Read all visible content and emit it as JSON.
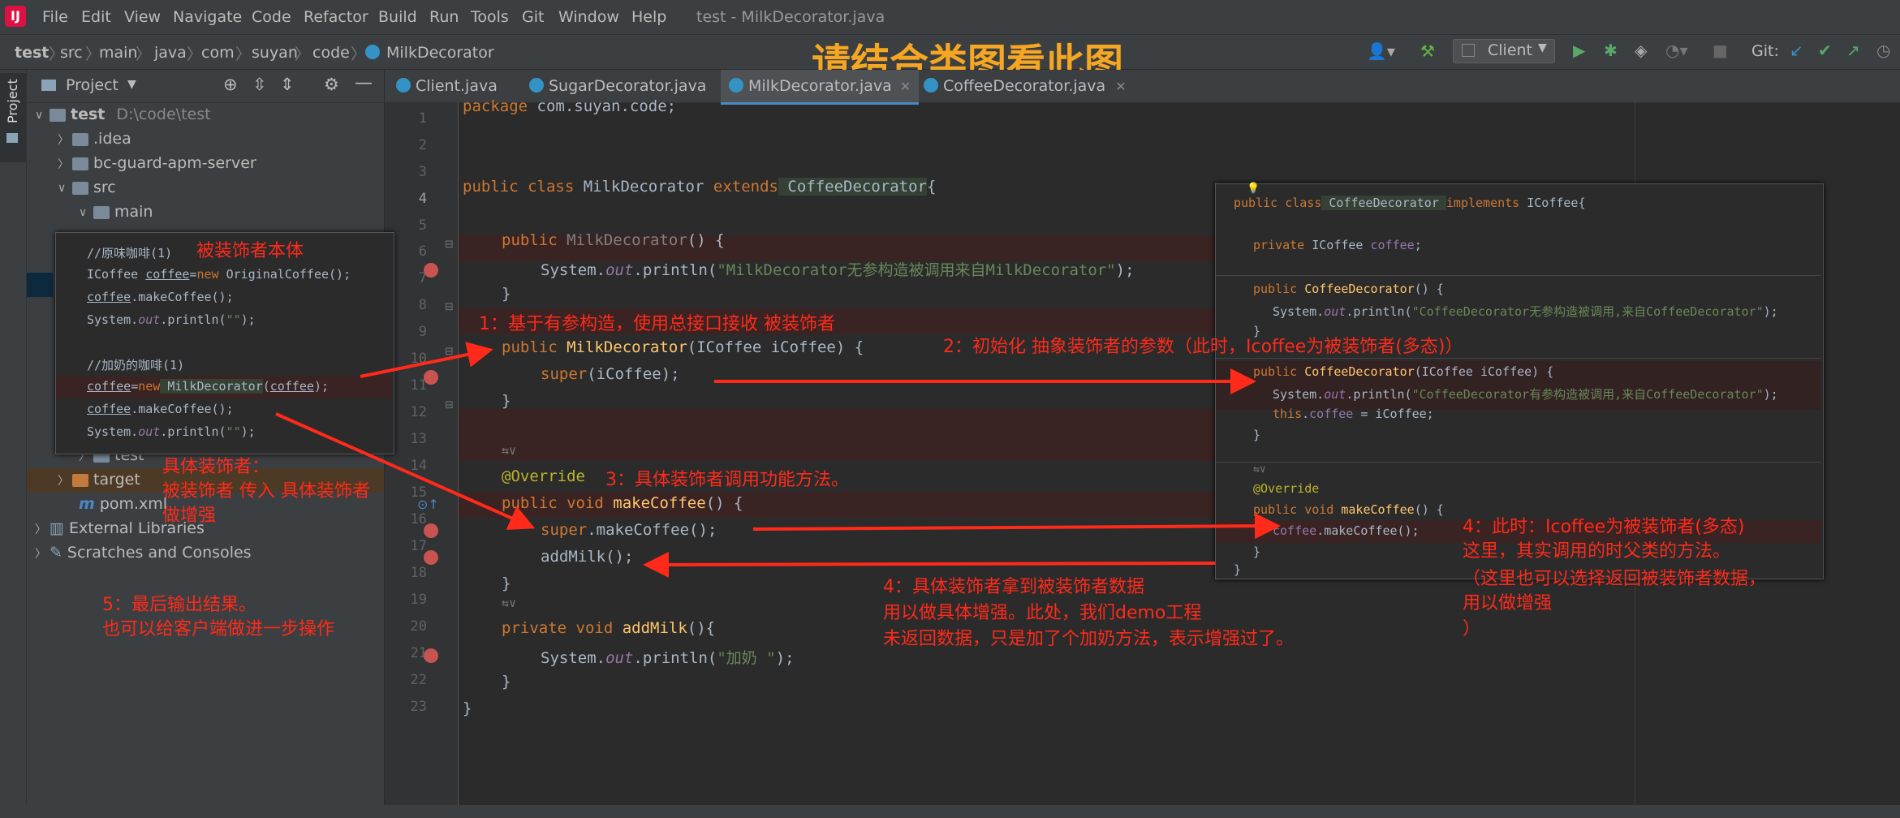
{
  "menubar": {
    "items": [
      "File",
      "Edit",
      "View",
      "Navigate",
      "Code",
      "Refactor",
      "Build",
      "Run",
      "Tools",
      "Git",
      "Window",
      "Help"
    ],
    "window_title": "test - MilkDecorator.java"
  },
  "breadcrumb": [
    "test",
    "src",
    "main",
    "java",
    "com",
    "suyan",
    "code",
    "MilkDecorator"
  ],
  "banner": "请结合类图看此图",
  "toolbar": {
    "run_config": "Client",
    "git_label": "Git:"
  },
  "project_panel": {
    "title": "Project",
    "root_name": "test",
    "root_path": "D:\\code\\test",
    "items": [
      ".idea",
      "bc-guard-apm-server",
      "src",
      "main",
      "test",
      "target",
      "pom.xml",
      "External Libraries",
      "Scratches and Consoles"
    ]
  },
  "tabs": [
    "Client.java",
    "SugarDecorator.java",
    "MilkDecorator.java",
    "CoffeeDecorator.java"
  ],
  "line_numbers": [
    "1",
    "2",
    "3",
    "4",
    "5",
    "6",
    "7",
    "8",
    "9",
    "10",
    "11",
    "12",
    "13",
    "14",
    "15",
    "16",
    "17",
    "18",
    "19",
    "20",
    "21",
    "22",
    "23"
  ],
  "code": {
    "l1_kw": "package",
    "l1_rest": " com.suyan.code;",
    "l4_kw1": "public class",
    "l4_name": " MilkDecorator ",
    "l4_kw2": "extends",
    "l4_sup": " CoffeeDecorator",
    "l4_end": "{",
    "l6_kw": "public",
    "l6_name": " MilkDecorator",
    "l6_end": "() {",
    "l7_a": "System.",
    "l7_out": "out",
    "l7_b": ".println(",
    "l7_str": "\"MilkDecorator无参构造被调用来自MilkDecorator\"",
    "l7_c": ");",
    "l8": "}",
    "l10_kw": "public",
    "l10_name": " MilkDecorator",
    "l10_rest": "(ICoffee iCoffee) {",
    "l11_kw": "super",
    "l11_rest": "(iCoffee);",
    "l12": "}",
    "l14_hint": "⇆∨",
    "l15_ann": "@Override",
    "l16_kw": "public void",
    "l16_name": " makeCoffee",
    "l16_rest": "() {",
    "l17_kw": "super",
    "l17_rest": ".makeCoffee();",
    "l18": "addMilk();",
    "l19": "}",
    "l20_hint": "⇆∨",
    "l21_kw": "private void",
    "l21_name": " addMilk",
    "l21_rest": "(){",
    "l22_a": "System.",
    "l22_out": "out",
    "l22_b": ".println(",
    "l22_str": "\"加奶 \"",
    "l22_c": ");",
    "l23": "}",
    "l24": "}"
  },
  "popup_left": {
    "c1": "//原味咖啡(1)",
    "l1_a": "ICoffee ",
    "l1_var": "coffee",
    "l1_b": "=",
    "l1_kw": "new",
    "l1_c": " OriginalCoffee();",
    "l2_var": "coffee",
    "l2_rest": ".makeCoffee();",
    "l3_a": "System.",
    "l3_out": "out",
    "l3_b": ".println(",
    "l3_str": "\"\"",
    "l3_c": ");",
    "c2": "//加奶的咖啡(1)",
    "l4_var": "coffee",
    "l4_b": "=",
    "l4_kw": "new",
    "l4_cls": " MilkDecorator",
    "l4_c": "(",
    "l4_arg": "coffee",
    "l4_d": ");",
    "l5_var": "coffee",
    "l5_rest": ".makeCoffee();",
    "l6_a": "System.",
    "l6_out": "out",
    "l6_b": ".println(",
    "l6_str": "\"\"",
    "l6_c": ");"
  },
  "popup_right": {
    "l1_kw": "public class",
    "l1_name": " CoffeeDecorator ",
    "l1_kw2": "implements",
    "l1_rest": " ICoffee{",
    "l2_kw": "private",
    "l2_type": " ICoffee ",
    "l2_fld": "coffee",
    "l2_end": ";",
    "l3_kw": "public",
    "l3_name": " CoffeeDecorator",
    "l3_rest": "() {",
    "l4_a": "System.",
    "l4_out": "out",
    "l4_b": ".println(",
    "l4_str": "\"CoffeeDecorator无参构造被调用,来自CoffeeDecorator\"",
    "l4_c": ");",
    "l5": "}",
    "l6_kw": "public",
    "l6_name": " CoffeeDecorator",
    "l6_rest": "(ICoffee iCoffee) {",
    "l7_a": "System.",
    "l7_out": "out",
    "l7_b": ".println(",
    "l7_str": "\"CoffeeDecorator有参构造被调用,来自CoffeeDecorator\"",
    "l7_c": ");",
    "l8_kw": "this",
    "l8_b": ".",
    "l8_fld": "coffee",
    "l8_c": " = iCoffee;",
    "l9": "}",
    "l10_hint": "⇆∨",
    "l11_ann": "@Override",
    "l12_kw": "public void",
    "l12_name": " makeCoffee",
    "l12_rest": "() {",
    "l13_fld": "coffee",
    "l13_rest": ".makeCoffee();",
    "l14": "}",
    "l15": "}"
  },
  "annotations": {
    "a_body": "被装饰者本体",
    "a1": "1：基于有参构造，使用总接口接收 被装饰者",
    "a2": "2：初始化  抽象装饰者的参数（此时，Icoffee为被装饰者(多态)）",
    "a3": "3：具体装饰者调用功能方法。",
    "a_concrete_1": "具体装饰者：",
    "a_concrete_2": "被装饰者 传入 具体装饰者",
    "a_concrete_3": "做增强",
    "a4_right_1": "4：此时：Icoffee为被装饰者(多态)",
    "a4_right_2": "这里，其实调用的时父类的方法。",
    "a4_right_3": "（这里也可以选择返回被装饰者数据，",
    "a4_right_4": "用以做增强",
    "a4_right_5": "）",
    "a4_mid_1": "4：具体装饰者拿到被装饰者数据",
    "a4_mid_2": "用以做具体增强。此处，我们demo工程",
    "a4_mid_3": "未返回数据，只是加了个加奶方法，表示增强过了。",
    "a5_1": "5：最后输出结果。",
    "a5_2": "也可以给客户端做进一步操作"
  },
  "colors": {
    "annotation": "#ff2a1a",
    "banner": "#f5a623",
    "editor_bg": "#2b2b2b",
    "panel_bg": "#3c3f41"
  }
}
